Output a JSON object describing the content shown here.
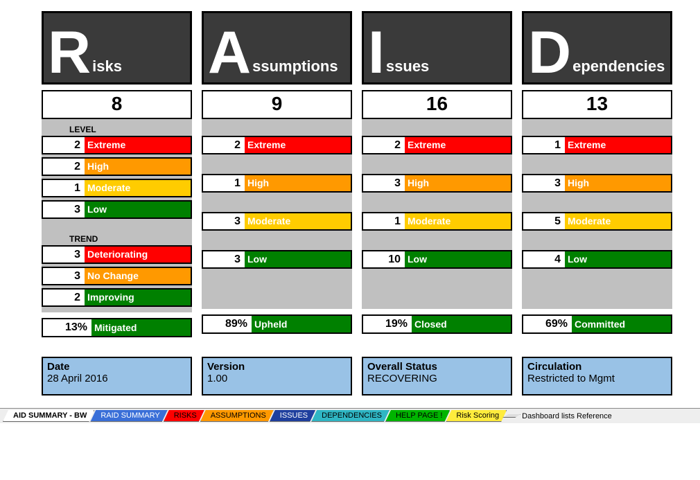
{
  "columns": [
    {
      "letter": "R",
      "rest": "isks",
      "total": "8",
      "section1_label": "LEVEL",
      "levels": [
        {
          "count": "2",
          "label": "Extreme",
          "cls": "c-extreme"
        },
        {
          "count": "2",
          "label": "High",
          "cls": "c-high"
        },
        {
          "count": "1",
          "label": "Moderate",
          "cls": "c-moderate"
        },
        {
          "count": "3",
          "label": "Low",
          "cls": "c-low"
        }
      ],
      "section2_label": "TREND",
      "trends": [
        {
          "count": "3",
          "label": "Deteriorating",
          "cls": "c-deter"
        },
        {
          "count": "3",
          "label": "No Change",
          "cls": "c-nochg"
        },
        {
          "count": "2",
          "label": "Improving",
          "cls": "c-improv"
        }
      ],
      "pct": "13%",
      "pct_label": "Mitigated"
    },
    {
      "letter": "A",
      "rest": "ssumptions",
      "total": "9",
      "levels": [
        {
          "count": "2",
          "label": "Extreme",
          "cls": "c-extreme"
        },
        {
          "count": "1",
          "label": "High",
          "cls": "c-high"
        },
        {
          "count": "3",
          "label": "Moderate",
          "cls": "c-moderate"
        },
        {
          "count": "3",
          "label": "Low",
          "cls": "c-low"
        }
      ],
      "pct": "89%",
      "pct_label": "Upheld"
    },
    {
      "letter": "I",
      "rest": "ssues",
      "total": "16",
      "levels": [
        {
          "count": "2",
          "label": "Extreme",
          "cls": "c-extreme"
        },
        {
          "count": "3",
          "label": "High",
          "cls": "c-high"
        },
        {
          "count": "1",
          "label": "Moderate",
          "cls": "c-moderate"
        },
        {
          "count": "10",
          "label": "Low",
          "cls": "c-low"
        }
      ],
      "pct": "19%",
      "pct_label": "Closed"
    },
    {
      "letter": "D",
      "rest": "ependencies",
      "total": "13",
      "levels": [
        {
          "count": "1",
          "label": "Extreme",
          "cls": "c-extreme"
        },
        {
          "count": "3",
          "label": "High",
          "cls": "c-high"
        },
        {
          "count": "5",
          "label": "Moderate",
          "cls": "c-moderate"
        },
        {
          "count": "4",
          "label": "Low",
          "cls": "c-low"
        }
      ],
      "pct": "69%",
      "pct_label": "Committed"
    }
  ],
  "info": [
    {
      "title": "Date",
      "value": "28 April 2016"
    },
    {
      "title": "Version",
      "value": "1.00"
    },
    {
      "title": "Overall Status",
      "value": "RECOVERING"
    },
    {
      "title": "Circulation",
      "value": "Restricted to Mgmt"
    }
  ],
  "tabs": {
    "active": "AID SUMMARY - BW",
    "items": [
      {
        "label": "RAID SUMMARY",
        "cls": "t-blue"
      },
      {
        "label": "RISKS",
        "cls": "t-red"
      },
      {
        "label": "ASSUMPTIONS",
        "cls": "t-orange"
      },
      {
        "label": "ISSUES",
        "cls": "t-dblue"
      },
      {
        "label": "DEPENDENCIES",
        "cls": "t-cyan"
      },
      {
        "label": "HELP PAGE !",
        "cls": "t-green"
      },
      {
        "label": "Risk Scoring",
        "cls": "t-yellow"
      }
    ],
    "trail": "Dashboard lists Reference"
  },
  "chart_data": {
    "type": "table",
    "title": "RAID Summary Dashboard",
    "date": "28 April 2016",
    "version": "1.00",
    "overall_status": "RECOVERING",
    "circulation": "Restricted to Mgmt",
    "categories": [
      "Risks",
      "Assumptions",
      "Issues",
      "Dependencies"
    ],
    "totals": [
      8,
      9,
      16,
      13
    ],
    "level_rows": [
      "Extreme",
      "High",
      "Moderate",
      "Low"
    ],
    "levels": {
      "Risks": [
        2,
        2,
        1,
        3
      ],
      "Assumptions": [
        2,
        1,
        3,
        3
      ],
      "Issues": [
        2,
        3,
        1,
        10
      ],
      "Dependencies": [
        1,
        3,
        5,
        4
      ]
    },
    "risk_trend": {
      "Deteriorating": 3,
      "No Change": 3,
      "Improving": 2
    },
    "status_pct": {
      "Risks": {
        "label": "Mitigated",
        "pct": 13
      },
      "Assumptions": {
        "label": "Upheld",
        "pct": 89
      },
      "Issues": {
        "label": "Closed",
        "pct": 19
      },
      "Dependencies": {
        "label": "Committed",
        "pct": 69
      }
    }
  }
}
